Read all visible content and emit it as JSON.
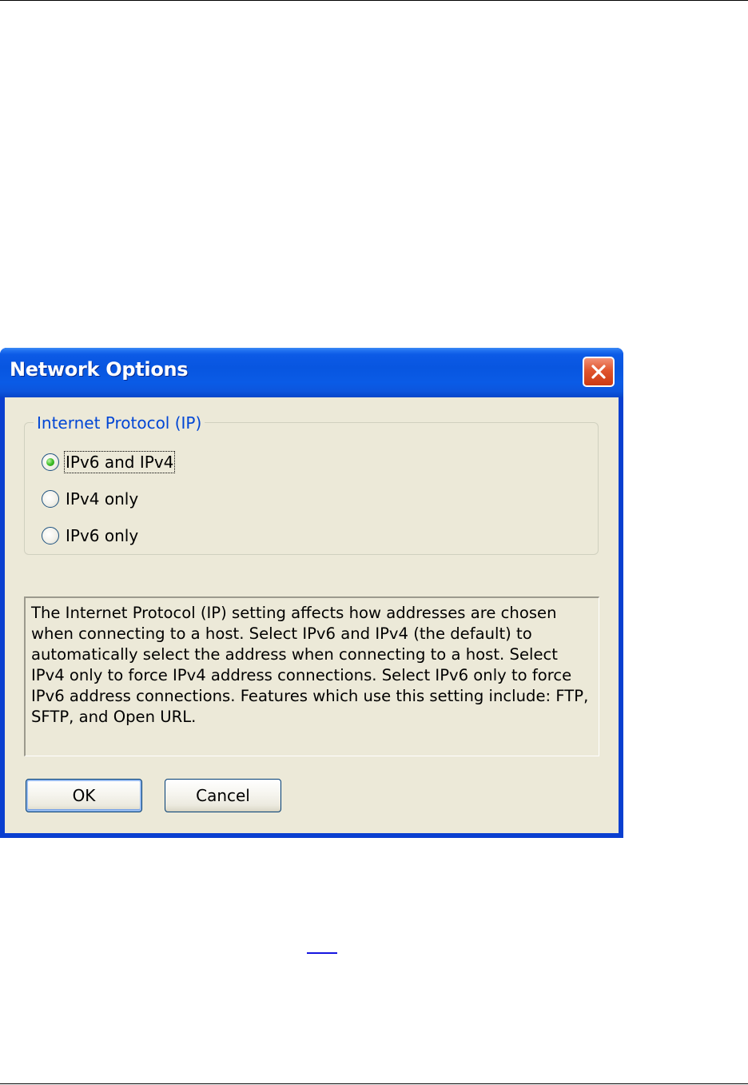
{
  "dialog": {
    "title": "Network Options",
    "close_icon": "close-icon",
    "colors": {
      "titlebar": "#0856e0",
      "client": "#ece9d8",
      "group_label": "#0046d5",
      "close_button": "#e0552e"
    }
  },
  "group": {
    "label": "Internet Protocol (IP)",
    "options": [
      {
        "label": "IPv6 and IPv4",
        "checked": true
      },
      {
        "label": "IPv4 only",
        "checked": false
      },
      {
        "label": "IPv6 only",
        "checked": false
      }
    ]
  },
  "description": "The Internet Protocol (IP) setting affects how addresses are chosen when connecting to a host. Select IPv6 and IPv4 (the default) to automatically select the address when connecting to a host. Select IPv4 only to force IPv4 address connections. Select IPv6 only to force IPv6 address connections. Features which use this setting include: FTP, SFTP, and Open URL.",
  "buttons": {
    "ok": "OK",
    "cancel": "Cancel"
  }
}
